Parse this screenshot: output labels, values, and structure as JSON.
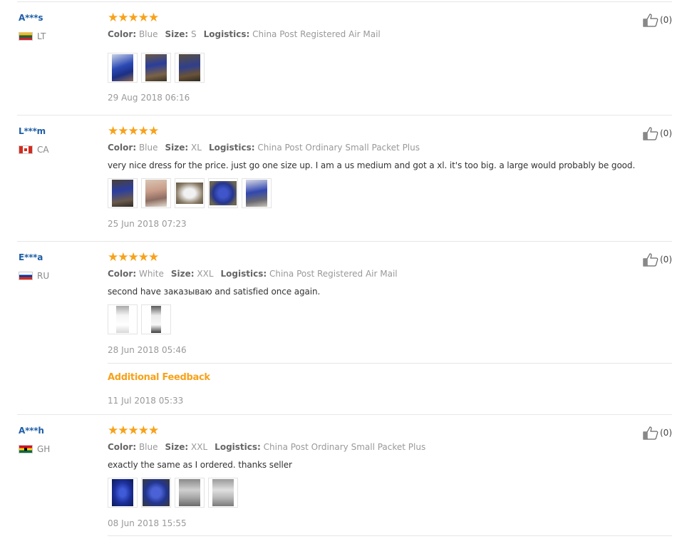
{
  "labels": {
    "color": "Color:",
    "size": "Size:",
    "logistics": "Logistics:",
    "additional_feedback": "Additional Feedback"
  },
  "star_glyphs": "★★★★★",
  "reviews": [
    {
      "buyer": "A***s",
      "country": "LT",
      "rating": 5,
      "color": "Blue",
      "size": "S",
      "logistics": "China Post Registered Air Mail",
      "comment": "",
      "images": 3,
      "date": "29 Aug 2018 06:16",
      "likes": "(0)"
    },
    {
      "buyer": "L***m",
      "country": "CA",
      "rating": 5,
      "color": "Blue",
      "size": "XL",
      "logistics": "China Post Ordinary Small Packet Plus",
      "comment": "very nice dress for the price. just go one size up. I am a us medium and got a xl. it's too big. a large would probably be good.",
      "images": 5,
      "date": "25 Jun 2018 07:23",
      "likes": "(0)"
    },
    {
      "buyer": "E***a",
      "country": "RU",
      "rating": 5,
      "color": "White",
      "size": "XXL",
      "logistics": "China Post Registered Air Mail",
      "comment": "second have заказываю and satisfied once again.",
      "images": 2,
      "date": "28 Jun 2018 05:46",
      "additional_date": "11 Jul 2018 05:33",
      "likes": "(0)"
    },
    {
      "buyer": "A***h",
      "country": "GH",
      "rating": 5,
      "color": "Blue",
      "size": "XXL",
      "logistics": "China Post Ordinary Small Packet Plus",
      "comment": "exactly the same as I ordered. thanks seller",
      "images": 4,
      "date": "08 Jun 2018 15:55",
      "likes": "(0)"
    }
  ],
  "colors": {
    "star": "#f7a21b",
    "buyer_link": "#1f5fa6",
    "additional_feedback": "#f7a21b"
  }
}
